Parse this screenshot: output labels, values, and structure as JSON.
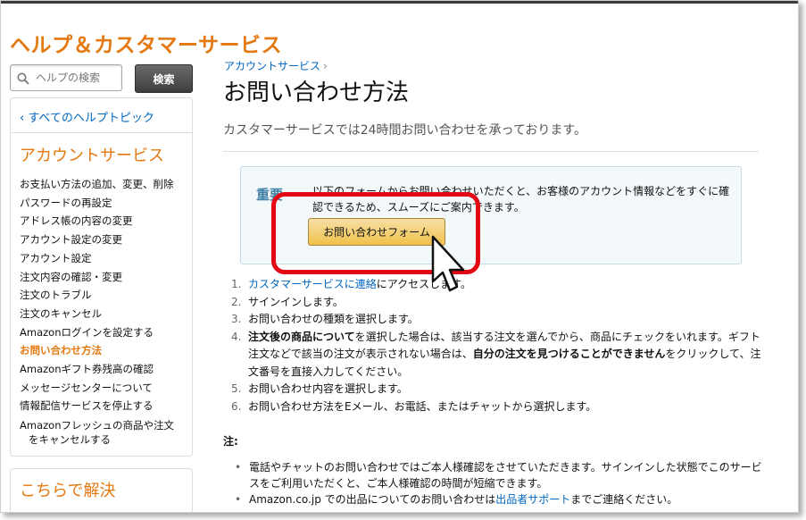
{
  "header": {
    "title": "ヘルプ＆カスタマーサービス"
  },
  "search": {
    "placeholder": "ヘルプの検索",
    "button_label": "検索",
    "icon": "search-icon"
  },
  "sidebar": {
    "back_link": "‹ すべてのヘルプトピック",
    "heading": "アカウントサービス",
    "items": [
      {
        "label": "お支払い方法の追加、変更、削除"
      },
      {
        "label": "パスワードの再設定"
      },
      {
        "label": "アドレス帳の内容の変更"
      },
      {
        "label": "アカウント設定の変更"
      },
      {
        "label": "アカウント設定"
      },
      {
        "label": "注文内容の確認・変更"
      },
      {
        "label": "注文のトラブル"
      },
      {
        "label": "注文のキャンセル"
      },
      {
        "label": "Amazonログインを設定する"
      },
      {
        "label": "お問い合わせ方法",
        "active": true
      },
      {
        "label": "Amazonギフト券残高の確認"
      },
      {
        "label": "メッセージセンターについて"
      },
      {
        "label": "情報配信サービスを停止する"
      },
      {
        "label": "Amazonフレッシュの商品や注文",
        "label2": "をキャンセルする"
      }
    ],
    "second_heading": "こちらで解決"
  },
  "main": {
    "breadcrumb": "アカウントサービス",
    "breadcrumb_sep": "›",
    "title": "お問い合わせ方法",
    "subtitle": "カスタマーサービスでは24時間お問い合わせを承っております。",
    "notice": {
      "label": "重要",
      "text": "以下のフォームからお問い合わせいただくと、お客様のアカウント情報などをすぐに確認できるため、スムーズにご案内できます。",
      "button_label": "お問い合わせフォーム"
    },
    "steps": [
      {
        "num": "1.",
        "link": "カスタマーサービスに連絡",
        "text": "にアクセスします。"
      },
      {
        "num": "2.",
        "text": "サインインします。"
      },
      {
        "num": "3.",
        "text": "お問い合わせの種類を選択します。"
      },
      {
        "num": "4.",
        "bold": "注文後の商品について",
        "text": "を選択した場合は、該当する注文を選んでから、商品にチェックをいれます。ギフト注文などで該当の注文が表示されない場合は、",
        "bold2": "自分の注文を見つけることができません",
        "text2": "をクリックして、注文番号を直接入力してください。"
      },
      {
        "num": "5.",
        "text": "お問い合わせ内容を選択します。"
      },
      {
        "num": "6.",
        "text": "お問い合わせ方法をEメール、お電話、またはチャットから選択します。"
      }
    ],
    "note_heading": "注:",
    "notes": [
      {
        "text": "電話やチャットのお問い合わせではご本人様確認をさせていただきます。サインインした状態でこのサービスをご利用いただくと、ご本人様確認の時間が短縮できます。"
      },
      {
        "text": "Amazon.co.jp での出品についてのお問い合わせは",
        "link": "出品者サポート",
        "text2": "までご連絡ください。"
      }
    ]
  },
  "colors": {
    "accent": "#e47911",
    "link": "#0066c0",
    "highlight": "#e30613",
    "button": "#f0c14b"
  }
}
